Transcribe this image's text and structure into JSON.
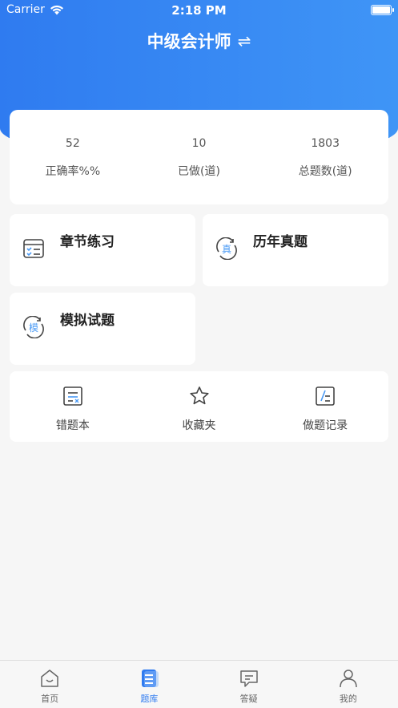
{
  "status_bar": {
    "carrier": "Carrier",
    "time": "2:18 PM"
  },
  "header": {
    "title": "中级会计师",
    "swap_icon": "⇌"
  },
  "stats": [
    {
      "value": "52",
      "label": "正确率%%"
    },
    {
      "value": "10",
      "label": "已做(道)"
    },
    {
      "value": "1803",
      "label": "总题数(道)"
    }
  ],
  "tiles": {
    "chapter": {
      "title": "章节练习"
    },
    "past": {
      "title": "历年真题",
      "icon_char": "真"
    },
    "mock": {
      "title": "模拟试题",
      "icon_char": "模"
    }
  },
  "tools": [
    {
      "label": "错题本"
    },
    {
      "label": "收藏夹"
    },
    {
      "label": "做题记录"
    }
  ],
  "tabs": [
    {
      "label": "首页"
    },
    {
      "label": "题库"
    },
    {
      "label": "答疑"
    },
    {
      "label": "我的"
    }
  ],
  "colors": {
    "accent": "#2f7bf0",
    "icon_blue": "#4a9af5"
  }
}
